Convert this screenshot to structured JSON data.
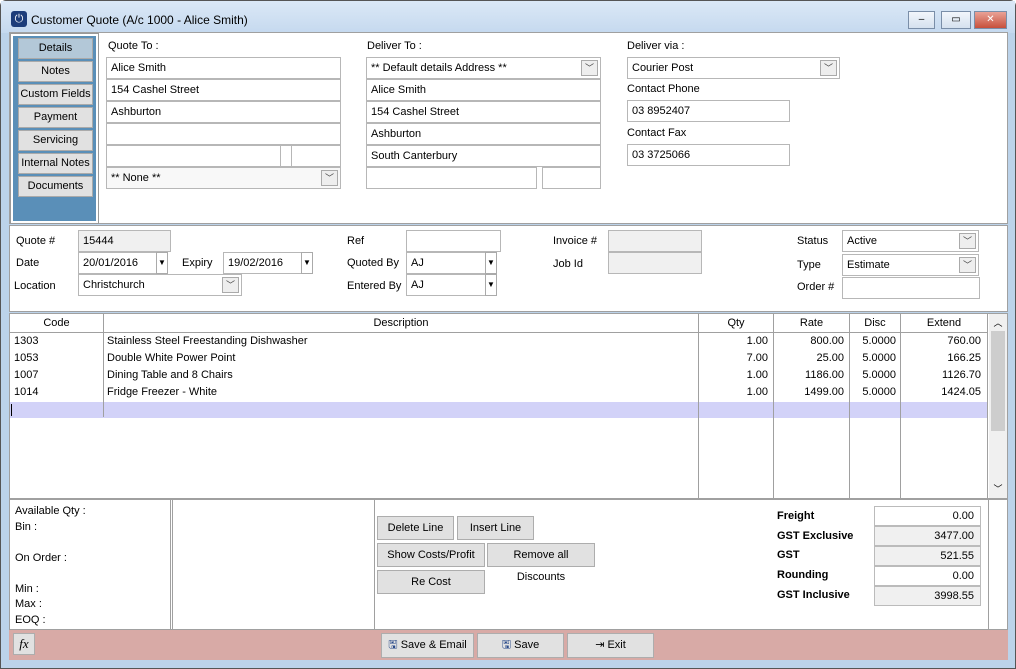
{
  "window": {
    "title": "Customer Quote (A/c 1000 - Alice Smith)",
    "minimize": "–",
    "maximize": "▭",
    "close": "✕"
  },
  "sidebar": {
    "items": [
      {
        "label": "Details",
        "active": true
      },
      {
        "label": "Notes"
      },
      {
        "label": "Custom Fields"
      },
      {
        "label": "Payment"
      },
      {
        "label": "Servicing"
      },
      {
        "label": "Internal Notes"
      },
      {
        "label": "Documents"
      }
    ]
  },
  "quote_to": {
    "label": "Quote To :",
    "lines": [
      "Alice Smith",
      "154 Cashel Street",
      "Ashburton",
      ""
    ],
    "select": "** None **"
  },
  "deliver_to": {
    "label": "Deliver To :",
    "select": "** Default details Address **",
    "lines": [
      "Alice Smith",
      "154 Cashel Street",
      "Ashburton",
      "South Canterbury"
    ]
  },
  "deliver_via": {
    "label": "Deliver via :",
    "select": "Courier Post",
    "phone_label": "Contact Phone",
    "phone": "03 8952407",
    "fax_label": "Contact Fax",
    "fax": "03 3725066"
  },
  "header": {
    "quote_no_label": "Quote #",
    "quote_no": "15444",
    "date_label": "Date",
    "date": "20/01/2016",
    "expiry_label": "Expiry",
    "expiry": "19/02/2016",
    "location_label": "Location",
    "location": "Christchurch",
    "ref_label": "Ref",
    "ref": "",
    "quoted_by_label": "Quoted By",
    "quoted_by": "AJ",
    "entered_by_label": "Entered By",
    "entered_by": "AJ",
    "invoice_label": "Invoice #",
    "invoice": "",
    "job_label": "Job Id",
    "job": "",
    "status_label": "Status",
    "status": "Active",
    "type_label": "Type",
    "type": "Estimate",
    "order_label": "Order #",
    "order": ""
  },
  "grid": {
    "columns": [
      "Code",
      "Description",
      "Qty",
      "Rate",
      "Disc",
      "Extend"
    ],
    "rows": [
      [
        "1303",
        "Stainless Steel Freestanding Dishwasher",
        "1.00",
        "800.00",
        "5.0000",
        "760.00"
      ],
      [
        "1053",
        "Double White Power Point",
        "7.00",
        "25.00",
        "5.0000",
        "166.25"
      ],
      [
        "1007",
        "Dining Table and 8 Chairs",
        "1.00",
        "1186.00",
        "5.0000",
        "1126.70"
      ],
      [
        "1014",
        "Fridge Freezer - White",
        "1.00",
        "1499.00",
        "5.0000",
        "1424.05"
      ]
    ],
    "highlight_color": "#d2d2f8"
  },
  "stock": {
    "available": "Available Qty :",
    "bin": "Bin :",
    "on_order": "On Order :",
    "min": "Min :",
    "max": "Max :",
    "eoq": "EOQ :"
  },
  "actions": {
    "delete": "Delete Line",
    "insert": "Insert Line",
    "show_costs": "Show Costs/Profit",
    "remove_discounts": "Remove all Discounts",
    "recost": "Re Cost"
  },
  "totals": [
    {
      "label": "Freight",
      "value": "0.00"
    },
    {
      "label": "GST Exclusive",
      "value": "3477.00"
    },
    {
      "label": "GST",
      "value": "521.55"
    },
    {
      "label": "Rounding",
      "value": "0.00"
    },
    {
      "label": "GST Inclusive",
      "value": "3998.55"
    }
  ],
  "footer": {
    "fx": "fx",
    "save_email": "Save & Email",
    "save": "Save",
    "exit": "Exit",
    "color": "#d8aaa6"
  }
}
